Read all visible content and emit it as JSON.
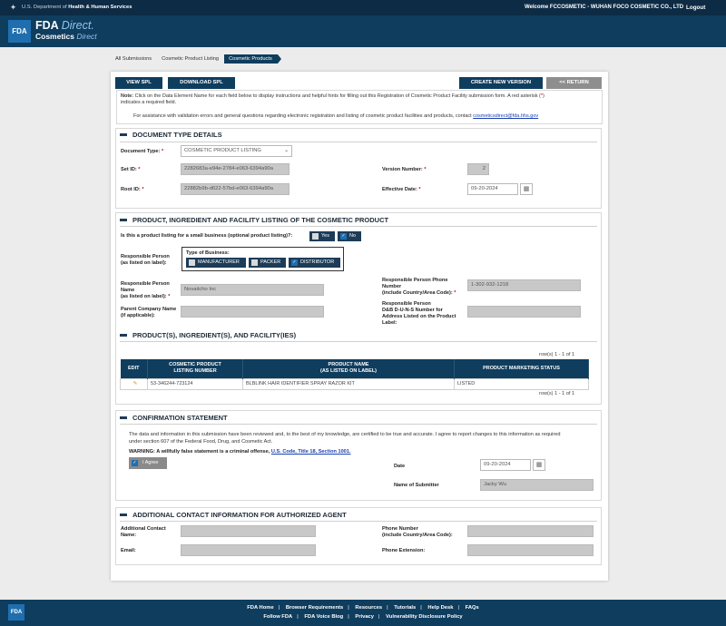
{
  "topbar": {
    "agency_prefix": "U.S. Department of",
    "agency_name": "Health & Human Services",
    "welcome": "Welcome FCCOSMETIC - WUHAN FOCO COSMETIC CO., LTD",
    "logout": "Logout"
  },
  "brand": {
    "logo": "FDA",
    "title": "FDA",
    "title_accent": "Direct.",
    "subtitle": "Cosmetics",
    "subtitle_accent": "Direct"
  },
  "breadcrumbs": [
    "All Submissions",
    "Cosmetic Product Listing",
    "Cosmetic Products"
  ],
  "toolbar": {
    "view_spl": "VIEW SPL",
    "download_spl": "DOWNLOAD SPL",
    "create_new_version": "CREATE NEW VERSION",
    "return": "<< RETURN"
  },
  "note": {
    "label": "Note:",
    "text1": "Click on the Data Element Name for each field below to display instructions and helpful hints for filling out this Registration of Cosmetic Product Facility submission form. A red asterisk (",
    "asterisk": "*",
    "text2": ")",
    "text3": "indicates a required field.",
    "assist": "For assistance with validation errors and general questions regarding electronic registration and listing of cosmetic product facilities and products, contact",
    "email": "cosmeticsdirect@fda.hhs.gov"
  },
  "doc_type": {
    "heading": "DOCUMENT TYPE DETAILS",
    "document_type_label": "Document Type:",
    "document_type_value": "COSMETIC PRODUCT LISTING",
    "set_id_label": "Set ID:",
    "set_id_value": "2282683a-e94e-2784-e063-6394a90a",
    "root_id_label": "Root ID:",
    "root_id_value": "22882b9b-d622-57bd-e063-6394a90a",
    "version_label": "Version Number:",
    "version_value": "2",
    "effective_date_label": "Effective Date:",
    "effective_date_value": "09-20-2024"
  },
  "listing": {
    "heading": "PRODUCT, INGREDIENT AND FACILITY LISTING OF THE COSMETIC PRODUCT",
    "small_business_q": "Is this a product listing for a small business (optional product listing)?:",
    "yes": "Yes",
    "no": "No",
    "resp_person_label_1": "Responsible Person",
    "resp_person_label_2": "(as listed on label):",
    "biz_type_label": "Type of Business:",
    "manufacturer": "MANUFACTURER",
    "packer": "PACKER",
    "distributor": "DISTRIBUTOR",
    "resp_name_label_1": "Responsible Person",
    "resp_name_label_2": "Name",
    "resp_name_label_3": "(as listed on label):",
    "resp_name_value": "Novaitcho Inc",
    "phone_label_1": "Responsible Person Phone",
    "phone_label_2": "Number",
    "phone_label_3": "(include Country/Area Code):",
    "phone_value": "1-302-932-1218",
    "parent_label_1": "Parent Company Name",
    "parent_label_2": "(if applicable):",
    "parent_value": "",
    "duns_label_1": "Responsible Person",
    "duns_label_2": "D&B D-U-N-S Number for",
    "duns_label_3": "Address Listed on the Product",
    "duns_label_4": "Label:",
    "duns_value": ""
  },
  "products": {
    "heading": "PRODUCT(S), INGREDIENT(S), AND FACILITY(IES)",
    "rows_info": "row(s) 1 - 1 of 1",
    "columns": [
      "EDIT",
      "COSMETIC PRODUCT LISTING NUMBER",
      "PRODUCT NAME (AS LISTED ON LABEL)",
      "PRODUCT MARKETING STATUS"
    ],
    "col_listing_1": "COSMETIC PRODUCT",
    "col_listing_2": "LISTING NUMBER",
    "col_name_1": "PRODUCT NAME",
    "col_name_2": "(AS LISTED ON LABEL)",
    "row": {
      "listing_number": "53-346244-723124",
      "product_name": "BLBLINK HAIR IDENTIFIER SPRAY RAZOR KIT",
      "status": "LISTED"
    }
  },
  "confirmation": {
    "heading": "CONFIRMATION STATEMENT",
    "text1": "The data and information in this submission have been reviewed and, to the best of my knowledge, are certified to be true and accurate. I agree to report changes to this information as required",
    "text2": "under section 607 of the Federal Food, Drug, and Cosmetic Act.",
    "warning": "WARNING: A willfully false statement is a criminal offense,",
    "warning_link": "U.S. Code, Title 18, Section 1001.",
    "agree": "I Agree",
    "date_label": "Date",
    "date_value": "09-20-2024",
    "submitter_label": "Name of Submitter",
    "submitter_value": "Jacky Wu"
  },
  "agent": {
    "heading": "ADDITIONAL CONTACT INFORMATION FOR AUTHORIZED AGENT",
    "contact_label_1": "Additional Contact",
    "contact_label_2": "Name:",
    "email_label": "Email:",
    "phone_label_1": "Phone Number",
    "phone_label_2": "(include Country/Area Code):",
    "ext_label": "Phone Extension:"
  },
  "footer": {
    "logo": "FDA",
    "row1": [
      "FDA Home",
      "Browser Requirements",
      "Resources",
      "Tutorials",
      "Help Desk",
      "FAQs"
    ],
    "row2": [
      "Follow FDA",
      "FDA Voice Blog",
      "Privacy",
      "Vulnerability Disclosure Policy"
    ]
  }
}
